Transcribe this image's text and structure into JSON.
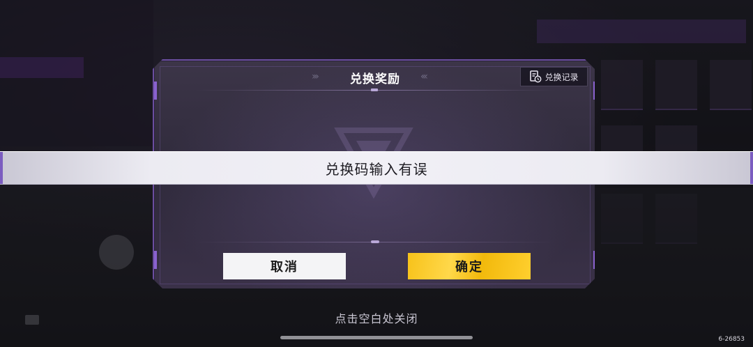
{
  "dialog": {
    "title": "兑换奖励",
    "title_left_deco": "›››",
    "title_right_deco": "‹‹‹",
    "history_button_label": "兑换记录",
    "history_icon": "redeem-history-icon",
    "cancel_label": "取消",
    "confirm_label": "确定"
  },
  "toast": {
    "message": "兑换码输入有误"
  },
  "footer": {
    "close_hint": "点击空白处关闭",
    "build_id": "6-26853"
  },
  "colors": {
    "accent_purple": "#6b4ea0",
    "confirm_yellow": "#f7c21a",
    "cancel_white": "#f4f4f6"
  }
}
